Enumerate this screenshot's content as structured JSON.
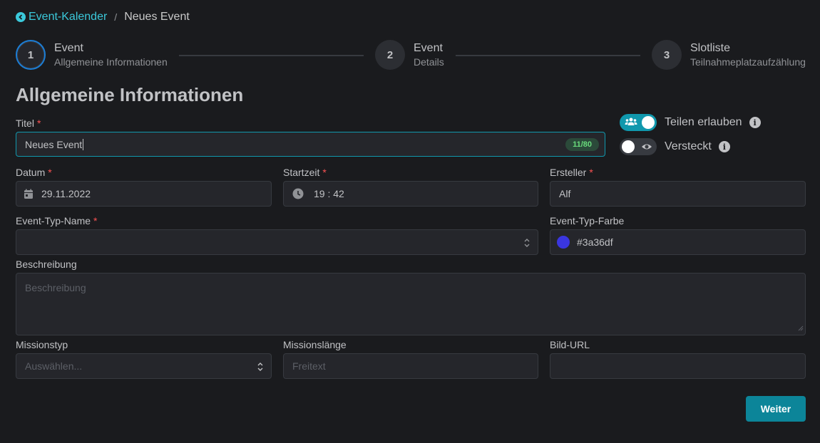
{
  "breadcrumb": {
    "back_label": "Event-Kalender",
    "separator": "/",
    "current": "Neues Event"
  },
  "stepper": {
    "steps": [
      {
        "number": "1",
        "title": "Event",
        "description": "Allgemeine Informationen"
      },
      {
        "number": "2",
        "title": "Event",
        "description": "Details"
      },
      {
        "number": "3",
        "title": "Slotliste",
        "description": "Teilnahmeplatzaufzählung"
      }
    ],
    "active_step": 1
  },
  "page_title": "Allgemeine Informationen",
  "form": {
    "title": {
      "label": "Titel",
      "required": "*",
      "value": "Neues Event",
      "counter": "11/80"
    },
    "share_toggle": {
      "label": "Teilen erlauben",
      "on": true,
      "icon": "users-icon"
    },
    "hidden_toggle": {
      "label": "Versteckt",
      "on": false,
      "icon": "eye-icon"
    },
    "date": {
      "label": "Datum",
      "required": "*",
      "value": "29.11.2022",
      "icon": "calendar-icon"
    },
    "start_time": {
      "label": "Startzeit",
      "required": "*",
      "value": "19 : 42",
      "icon": "clock-icon"
    },
    "creator": {
      "label": "Ersteller",
      "required": "*",
      "value": "Alf"
    },
    "event_type_name": {
      "label": "Event-Typ-Name",
      "required": "*",
      "value": ""
    },
    "event_type_color": {
      "label": "Event-Typ-Farbe",
      "value": "#3a36df",
      "swatch": "#3a36df"
    },
    "description": {
      "label": "Beschreibung",
      "placeholder": "Beschreibung"
    },
    "mission_type": {
      "label": "Missionstyp",
      "placeholder": "Auswählen..."
    },
    "mission_length": {
      "label": "Missionslänge",
      "placeholder": "Freitext"
    },
    "image_url": {
      "label": "Bild-URL",
      "value": ""
    }
  },
  "next_button": "Weiter",
  "colors": {
    "accent": "#3bc9db",
    "primary": "#0c8599",
    "toggle_on": "#1098ad",
    "required": "#fa5252"
  }
}
